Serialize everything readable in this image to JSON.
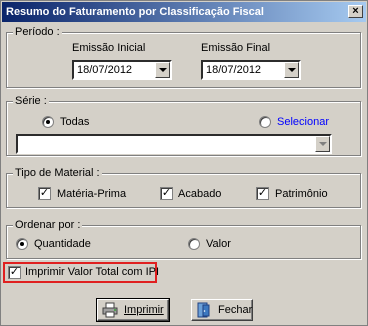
{
  "window": {
    "title": "Resumo do Faturamento por Classificação Fiscal",
    "close_glyph": "×"
  },
  "periodo": {
    "legend": "Período :",
    "inicial_label": "Emissão Inicial",
    "inicial_value": "18/07/2012",
    "final_label": "Emissão Final",
    "final_value": "18/07/2012"
  },
  "serie": {
    "legend": "Série :",
    "opt_todas": "Todas",
    "opt_selecionar": "Selecionar",
    "selected": "Todas",
    "combo_value": ""
  },
  "tipo_material": {
    "legend": "Tipo de Material :",
    "materia_prima": "Matéria-Prima",
    "acabado": "Acabado",
    "patrimonio": "Patrimônio"
  },
  "ordenar": {
    "legend": "Ordenar por :",
    "quantidade": "Quantidade",
    "valor": "Valor",
    "selected": "Quantidade"
  },
  "imprimir_ipi": {
    "label": "Imprimir Valor Total com IPI",
    "checked": true
  },
  "buttons": {
    "imprimir": "Imprimir",
    "fechar": "Fechar"
  },
  "colors": {
    "highlight": "#e02020",
    "link_blue": "#0000ff"
  }
}
